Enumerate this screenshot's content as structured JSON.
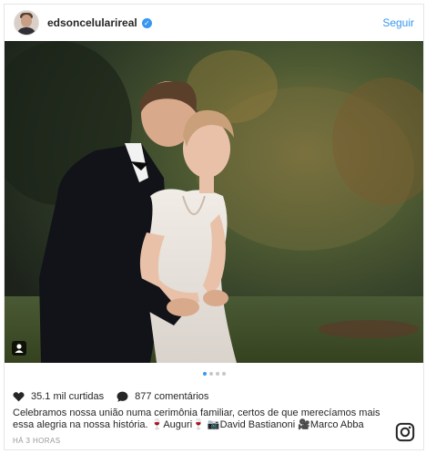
{
  "header": {
    "username": "edsoncelularireal",
    "follow_label": "Seguir",
    "verified_icon": "verified-check-icon"
  },
  "post": {
    "photo_description_icon": "tag-person-icon",
    "carousel": {
      "count": 4,
      "active_index": 0
    },
    "likes": "35.1 mil curtidas",
    "comments": "877 comentários",
    "caption": "Celebramos nossa união numa cerimônia familiar, certos de que merecíamos mais essa alegria na nossa história. 🍷Auguri🍷 📷David Bastianoni 🎥Marco Abba",
    "time": "HÁ 3 HORAS"
  },
  "colors": {
    "accent": "#3897f0",
    "text": "#262626",
    "muted": "#999999"
  }
}
